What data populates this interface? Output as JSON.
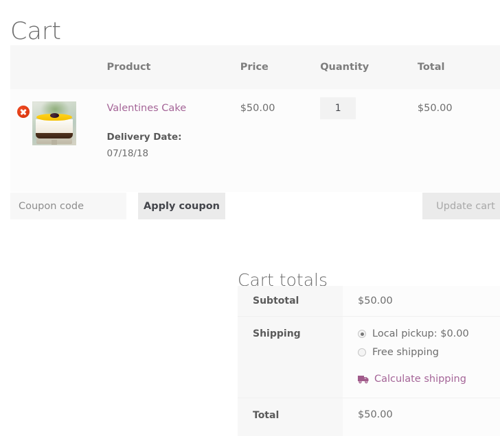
{
  "page": {
    "title": "Cart"
  },
  "cart_table": {
    "headers": {
      "remove": "",
      "thumbnail": "",
      "product": "Product",
      "price": "Price",
      "quantity": "Quantity",
      "total": "Total"
    },
    "items": [
      {
        "remove_icon": "remove-circle-x-icon",
        "thumbnail_icon": "product-thumbnail-cake-image",
        "name": "Valentines Cake",
        "meta_label": "Delivery Date:",
        "meta_value": "07/18/18",
        "price": "$50.00",
        "quantity": "1",
        "total": "$50.00"
      }
    ]
  },
  "actions": {
    "coupon_placeholder": "Coupon code",
    "coupon_value": "",
    "apply_coupon_label": "Apply coupon",
    "update_cart_label": "Update cart"
  },
  "cart_totals": {
    "title": "Cart totals",
    "subtotal_label": "Subtotal",
    "subtotal_value": "$50.00",
    "shipping_label": "Shipping",
    "shipping_options": [
      {
        "label": "Local pickup: $0.00",
        "selected": true
      },
      {
        "label": "Free shipping",
        "selected": false
      }
    ],
    "calculate_shipping_icon": "delivery-truck-icon",
    "calculate_shipping_label": "Calculate shipping",
    "total_label": "Total",
    "total_value": "$50.00"
  },
  "colors": {
    "link": "#a46497",
    "remove": "#e2401c",
    "header_bg": "#f7f7f7",
    "text": "#6d6d6d"
  }
}
